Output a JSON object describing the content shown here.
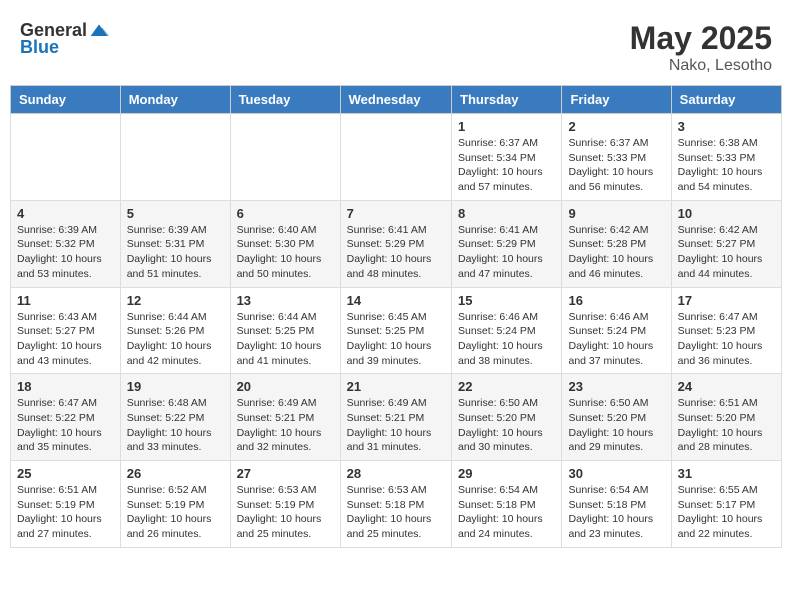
{
  "logo": {
    "general": "General",
    "blue": "Blue"
  },
  "title": {
    "month_year": "May 2025",
    "location": "Nako, Lesotho"
  },
  "headers": [
    "Sunday",
    "Monday",
    "Tuesday",
    "Wednesday",
    "Thursday",
    "Friday",
    "Saturday"
  ],
  "weeks": [
    [
      {
        "day": "",
        "sunrise": "",
        "sunset": "",
        "daylight": ""
      },
      {
        "day": "",
        "sunrise": "",
        "sunset": "",
        "daylight": ""
      },
      {
        "day": "",
        "sunrise": "",
        "sunset": "",
        "daylight": ""
      },
      {
        "day": "",
        "sunrise": "",
        "sunset": "",
        "daylight": ""
      },
      {
        "day": "1",
        "sunrise": "Sunrise: 6:37 AM",
        "sunset": "Sunset: 5:34 PM",
        "daylight": "Daylight: 10 hours and 57 minutes."
      },
      {
        "day": "2",
        "sunrise": "Sunrise: 6:37 AM",
        "sunset": "Sunset: 5:33 PM",
        "daylight": "Daylight: 10 hours and 56 minutes."
      },
      {
        "day": "3",
        "sunrise": "Sunrise: 6:38 AM",
        "sunset": "Sunset: 5:33 PM",
        "daylight": "Daylight: 10 hours and 54 minutes."
      }
    ],
    [
      {
        "day": "4",
        "sunrise": "Sunrise: 6:39 AM",
        "sunset": "Sunset: 5:32 PM",
        "daylight": "Daylight: 10 hours and 53 minutes."
      },
      {
        "day": "5",
        "sunrise": "Sunrise: 6:39 AM",
        "sunset": "Sunset: 5:31 PM",
        "daylight": "Daylight: 10 hours and 51 minutes."
      },
      {
        "day": "6",
        "sunrise": "Sunrise: 6:40 AM",
        "sunset": "Sunset: 5:30 PM",
        "daylight": "Daylight: 10 hours and 50 minutes."
      },
      {
        "day": "7",
        "sunrise": "Sunrise: 6:41 AM",
        "sunset": "Sunset: 5:29 PM",
        "daylight": "Daylight: 10 hours and 48 minutes."
      },
      {
        "day": "8",
        "sunrise": "Sunrise: 6:41 AM",
        "sunset": "Sunset: 5:29 PM",
        "daylight": "Daylight: 10 hours and 47 minutes."
      },
      {
        "day": "9",
        "sunrise": "Sunrise: 6:42 AM",
        "sunset": "Sunset: 5:28 PM",
        "daylight": "Daylight: 10 hours and 46 minutes."
      },
      {
        "day": "10",
        "sunrise": "Sunrise: 6:42 AM",
        "sunset": "Sunset: 5:27 PM",
        "daylight": "Daylight: 10 hours and 44 minutes."
      }
    ],
    [
      {
        "day": "11",
        "sunrise": "Sunrise: 6:43 AM",
        "sunset": "Sunset: 5:27 PM",
        "daylight": "Daylight: 10 hours and 43 minutes."
      },
      {
        "day": "12",
        "sunrise": "Sunrise: 6:44 AM",
        "sunset": "Sunset: 5:26 PM",
        "daylight": "Daylight: 10 hours and 42 minutes."
      },
      {
        "day": "13",
        "sunrise": "Sunrise: 6:44 AM",
        "sunset": "Sunset: 5:25 PM",
        "daylight": "Daylight: 10 hours and 41 minutes."
      },
      {
        "day": "14",
        "sunrise": "Sunrise: 6:45 AM",
        "sunset": "Sunset: 5:25 PM",
        "daylight": "Daylight: 10 hours and 39 minutes."
      },
      {
        "day": "15",
        "sunrise": "Sunrise: 6:46 AM",
        "sunset": "Sunset: 5:24 PM",
        "daylight": "Daylight: 10 hours and 38 minutes."
      },
      {
        "day": "16",
        "sunrise": "Sunrise: 6:46 AM",
        "sunset": "Sunset: 5:24 PM",
        "daylight": "Daylight: 10 hours and 37 minutes."
      },
      {
        "day": "17",
        "sunrise": "Sunrise: 6:47 AM",
        "sunset": "Sunset: 5:23 PM",
        "daylight": "Daylight: 10 hours and 36 minutes."
      }
    ],
    [
      {
        "day": "18",
        "sunrise": "Sunrise: 6:47 AM",
        "sunset": "Sunset: 5:22 PM",
        "daylight": "Daylight: 10 hours and 35 minutes."
      },
      {
        "day": "19",
        "sunrise": "Sunrise: 6:48 AM",
        "sunset": "Sunset: 5:22 PM",
        "daylight": "Daylight: 10 hours and 33 minutes."
      },
      {
        "day": "20",
        "sunrise": "Sunrise: 6:49 AM",
        "sunset": "Sunset: 5:21 PM",
        "daylight": "Daylight: 10 hours and 32 minutes."
      },
      {
        "day": "21",
        "sunrise": "Sunrise: 6:49 AM",
        "sunset": "Sunset: 5:21 PM",
        "daylight": "Daylight: 10 hours and 31 minutes."
      },
      {
        "day": "22",
        "sunrise": "Sunrise: 6:50 AM",
        "sunset": "Sunset: 5:20 PM",
        "daylight": "Daylight: 10 hours and 30 minutes."
      },
      {
        "day": "23",
        "sunrise": "Sunrise: 6:50 AM",
        "sunset": "Sunset: 5:20 PM",
        "daylight": "Daylight: 10 hours and 29 minutes."
      },
      {
        "day": "24",
        "sunrise": "Sunrise: 6:51 AM",
        "sunset": "Sunset: 5:20 PM",
        "daylight": "Daylight: 10 hours and 28 minutes."
      }
    ],
    [
      {
        "day": "25",
        "sunrise": "Sunrise: 6:51 AM",
        "sunset": "Sunset: 5:19 PM",
        "daylight": "Daylight: 10 hours and 27 minutes."
      },
      {
        "day": "26",
        "sunrise": "Sunrise: 6:52 AM",
        "sunset": "Sunset: 5:19 PM",
        "daylight": "Daylight: 10 hours and 26 minutes."
      },
      {
        "day": "27",
        "sunrise": "Sunrise: 6:53 AM",
        "sunset": "Sunset: 5:19 PM",
        "daylight": "Daylight: 10 hours and 25 minutes."
      },
      {
        "day": "28",
        "sunrise": "Sunrise: 6:53 AM",
        "sunset": "Sunset: 5:18 PM",
        "daylight": "Daylight: 10 hours and 25 minutes."
      },
      {
        "day": "29",
        "sunrise": "Sunrise: 6:54 AM",
        "sunset": "Sunset: 5:18 PM",
        "daylight": "Daylight: 10 hours and 24 minutes."
      },
      {
        "day": "30",
        "sunrise": "Sunrise: 6:54 AM",
        "sunset": "Sunset: 5:18 PM",
        "daylight": "Daylight: 10 hours and 23 minutes."
      },
      {
        "day": "31",
        "sunrise": "Sunrise: 6:55 AM",
        "sunset": "Sunset: 5:17 PM",
        "daylight": "Daylight: 10 hours and 22 minutes."
      }
    ]
  ]
}
